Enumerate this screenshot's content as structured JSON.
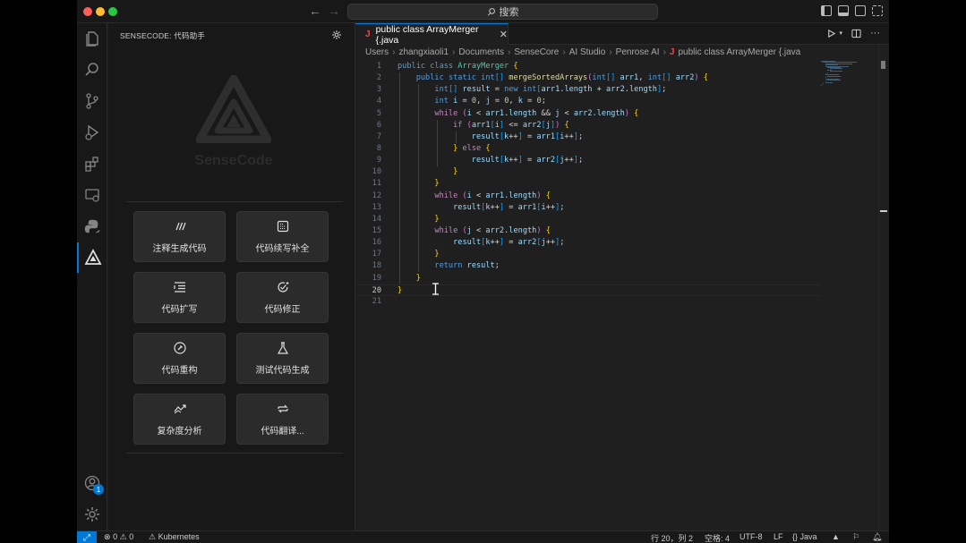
{
  "titlebar": {
    "search_label": "搜索"
  },
  "sidebar": {
    "title": "SENSECODE: 代码助手",
    "logo_text": "SenseCode",
    "cards": [
      {
        "label": "注释生成代码",
        "icon": "comment-slash-icon"
      },
      {
        "label": "代码续写补全",
        "icon": "code-completion-icon"
      },
      {
        "label": "代码扩写",
        "icon": "expand-list-icon"
      },
      {
        "label": "代码修正",
        "icon": "check-fix-icon"
      },
      {
        "label": "代码重构",
        "icon": "refactor-icon"
      },
      {
        "label": "测试代码生成",
        "icon": "beaker-icon"
      },
      {
        "label": "复杂度分析",
        "icon": "chart-trend-icon"
      },
      {
        "label": "代码翻译...",
        "icon": "arrows-swap-icon"
      }
    ]
  },
  "activitybar": {
    "items": [
      "explorer-icon",
      "search-icon",
      "source-control-icon",
      "run-debug-icon",
      "extensions-icon",
      "remote-explorer-icon",
      "python-icon",
      "sensecode-icon"
    ],
    "bottom": [
      "accounts-icon",
      "manage-gear-icon"
    ],
    "accounts_badge": "1"
  },
  "editor": {
    "tab_label": "public class ArrayMerger {.java",
    "breadcrumb": [
      "Users",
      "zhangxiaoli1",
      "Documents",
      "SenseCore",
      "AI Studio",
      "Penrose AI",
      "public class ArrayMerger {.java"
    ],
    "current_line": 20,
    "line_numbers": [
      "1",
      "2",
      "3",
      "4",
      "5",
      "6",
      "7",
      "8",
      "9",
      "10",
      "11",
      "12",
      "13",
      "14",
      "15",
      "16",
      "17",
      "18",
      "19",
      "20",
      "21"
    ],
    "code_lines": [
      "public class ArrayMerger {",
      "    public static int[] mergeSortedArrays(int[] arr1, int[] arr2) {",
      "        int[] result = new int[arr1.length + arr2.length];",
      "        int i = 0, j = 0, k = 0;",
      "        while (i < arr1.length && j < arr2.length) {",
      "            if (arr1[i] <= arr2[j]) {",
      "                result[k++] = arr1[i++];",
      "            } else {",
      "                result[k++] = arr2[j++];",
      "            }",
      "        }",
      "        while (i < arr1.length) {",
      "            result[k++] = arr1[i++];",
      "        }",
      "        while (j < arr2.length) {",
      "            result[k++] = arr2[j++];",
      "        }",
      "        return result;",
      "    }",
      "}",
      ""
    ]
  },
  "statusbar": {
    "errors": "0",
    "warnings": "0",
    "kubernetes": "Kubernetes",
    "position": "行 20，列 2",
    "spaces": "空格: 4",
    "encoding": "UTF-8",
    "eol": "LF",
    "language": "Java"
  },
  "colors": {
    "accent": "#0078d4",
    "editor_bg": "#1f1f1f",
    "sidebar_bg": "#181818",
    "card_bg": "#2b2b2b"
  }
}
